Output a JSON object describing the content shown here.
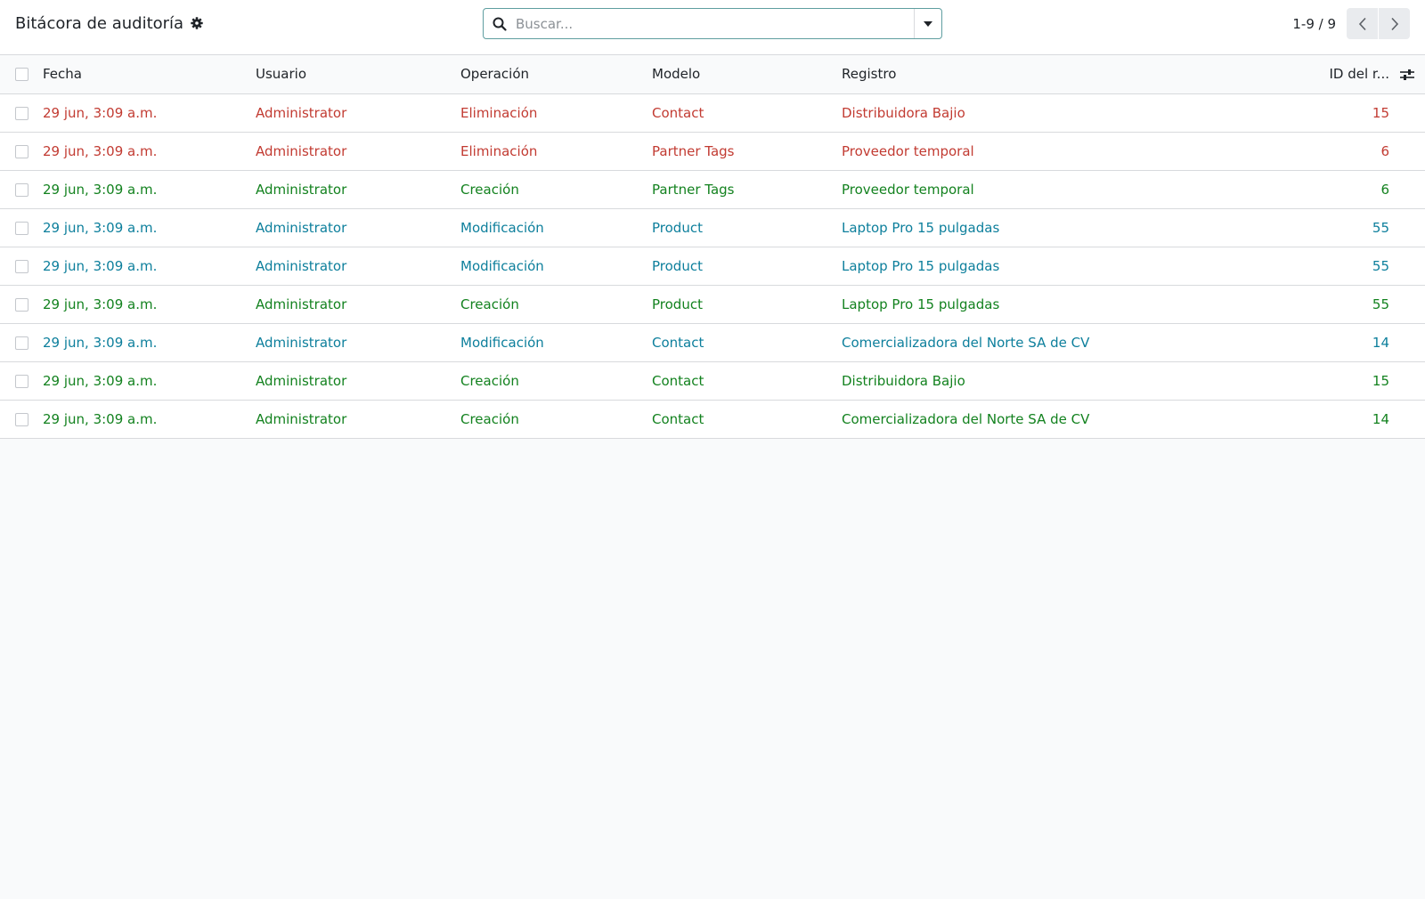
{
  "header": {
    "title": "Bitácora de auditoría",
    "settings_icon": "gear-icon",
    "search": {
      "placeholder": "Buscar...",
      "value": ""
    },
    "pager": {
      "value": "1-9 / 9"
    }
  },
  "colors": {
    "danger": "#c23b32",
    "success": "#13821f",
    "info": "#0d7f9c"
  },
  "table": {
    "columns": {
      "date": "Fecha",
      "user": "Usuario",
      "operation": "Operación",
      "model": "Modelo",
      "record": "Registro",
      "record_id": "ID del r..."
    },
    "rows": [
      {
        "status": "danger",
        "date": "29 jun, 3:09 a.m.",
        "user": "Administrator",
        "operation": "Eliminación",
        "model": "Contact",
        "record": "Distribuidora Bajio",
        "record_id": "15"
      },
      {
        "status": "danger",
        "date": "29 jun, 3:09 a.m.",
        "user": "Administrator",
        "operation": "Eliminación",
        "model": "Partner Tags",
        "record": "Proveedor temporal",
        "record_id": "6"
      },
      {
        "status": "success",
        "date": "29 jun, 3:09 a.m.",
        "user": "Administrator",
        "operation": "Creación",
        "model": "Partner Tags",
        "record": "Proveedor temporal",
        "record_id": "6"
      },
      {
        "status": "info",
        "date": "29 jun, 3:09 a.m.",
        "user": "Administrator",
        "operation": "Modificación",
        "model": "Product",
        "record": "Laptop Pro 15 pulgadas",
        "record_id": "55"
      },
      {
        "status": "info",
        "date": "29 jun, 3:09 a.m.",
        "user": "Administrator",
        "operation": "Modificación",
        "model": "Product",
        "record": "Laptop Pro 15 pulgadas",
        "record_id": "55"
      },
      {
        "status": "success",
        "date": "29 jun, 3:09 a.m.",
        "user": "Administrator",
        "operation": "Creación",
        "model": "Product",
        "record": "Laptop Pro 15 pulgadas",
        "record_id": "55"
      },
      {
        "status": "info",
        "date": "29 jun, 3:09 a.m.",
        "user": "Administrator",
        "operation": "Modificación",
        "model": "Contact",
        "record": "Comercializadora del Norte SA de CV",
        "record_id": "14"
      },
      {
        "status": "success",
        "date": "29 jun, 3:09 a.m.",
        "user": "Administrator",
        "operation": "Creación",
        "model": "Contact",
        "record": "Distribuidora Bajio",
        "record_id": "15"
      },
      {
        "status": "success",
        "date": "29 jun, 3:09 a.m.",
        "user": "Administrator",
        "operation": "Creación",
        "model": "Contact",
        "record": "Comercializadora del Norte SA de CV",
        "record_id": "14"
      }
    ]
  }
}
